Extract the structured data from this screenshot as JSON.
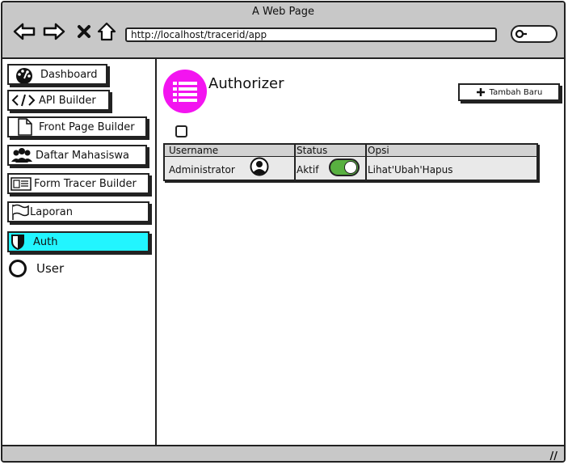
{
  "window": {
    "title": "A Web Page"
  },
  "browser": {
    "url": "http://localhost/tracerid/app"
  },
  "sidebar": {
    "items": [
      {
        "label": "Dashboard",
        "icon": "dashboard-icon"
      },
      {
        "label": "API Builder",
        "icon": "code-icon"
      },
      {
        "label": "Front Page Builder",
        "icon": "file-icon"
      },
      {
        "label": "Daftar Mahasiswa",
        "icon": "users-icon"
      },
      {
        "label": "Form Tracer Builder",
        "icon": "form-icon"
      },
      {
        "label": "Laporan",
        "icon": "flag-icon"
      },
      {
        "label": "Auth",
        "icon": "shield-icon",
        "active": true
      }
    ],
    "user": {
      "label": "User"
    }
  },
  "main": {
    "title": "Authorizer",
    "add_button": "Tambah Baru",
    "table": {
      "headers": {
        "username": "Username",
        "status": "Status",
        "options": "Opsi"
      },
      "rows": [
        {
          "username": "Administrator",
          "status": "Aktif",
          "status_on": true,
          "view": "Lihat",
          "sep1": "'",
          "edit": "Ubah",
          "sep2": "'",
          "delete": "Hapus"
        }
      ]
    }
  },
  "colors": {
    "accent": "#f314f0",
    "active_item": "#22f5ff",
    "toggle_on": "#58b040",
    "chrome": "#c8c8c8"
  }
}
